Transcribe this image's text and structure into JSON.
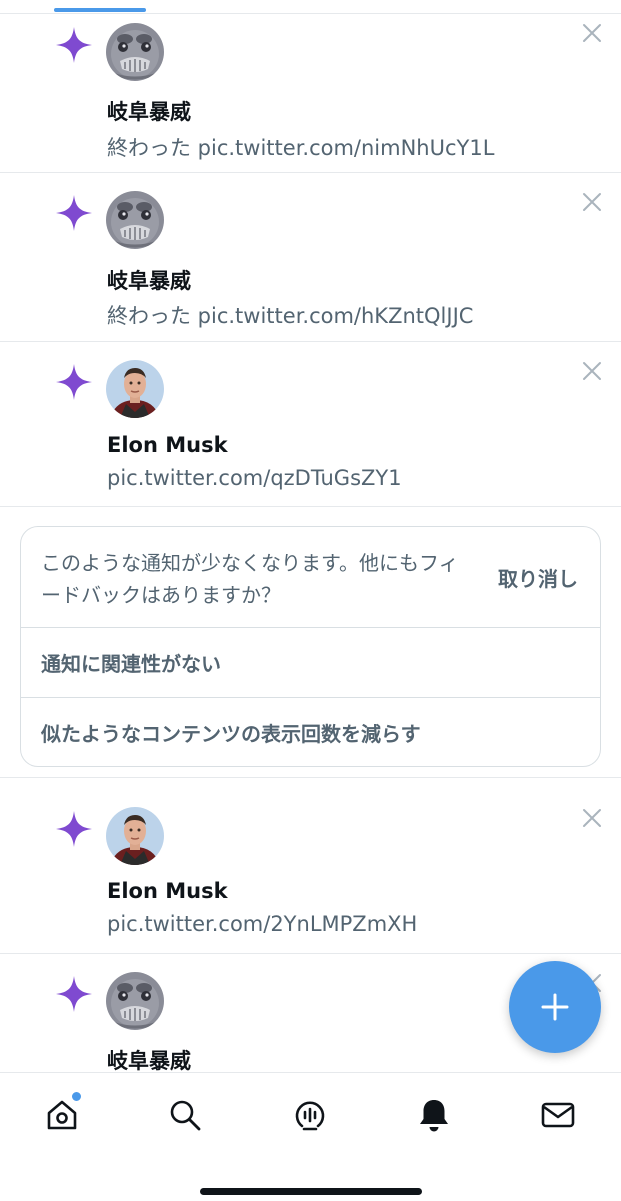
{
  "colors": {
    "accent": "#4a99e9",
    "star": "#7f4ad0",
    "secondary_text": "#536471",
    "primary_text": "#0f1419"
  },
  "notifications_top": [
    {
      "icon": "sparkle-icon",
      "avatar": "gifu-avatar",
      "name": "岐阜暴威",
      "text": "終わった pic.twitter.com/nimNhUcY1L"
    },
    {
      "icon": "sparkle-icon",
      "avatar": "gifu-avatar",
      "name": "岐阜暴威",
      "text": "終わった pic.twitter.com/hKZntQlJJC"
    },
    {
      "icon": "sparkle-icon",
      "avatar": "elon-avatar",
      "name": "Elon Musk",
      "text": "pic.twitter.com/qzDTuGsZY1"
    }
  ],
  "feedback": {
    "message": "このような通知が少なくなります。他にもフィードバックはありますか？",
    "undo_label": "取り消し",
    "options": [
      "通知に関連性がない",
      "似たようなコンテンツの表示回数を減らす"
    ]
  },
  "notifications_bottom": [
    {
      "icon": "sparkle-icon",
      "avatar": "elon-avatar",
      "name": "Elon Musk",
      "text": "pic.twitter.com/2YnLMPZmXH"
    },
    {
      "icon": "sparkle-icon",
      "avatar": "gifu-avatar",
      "name": "岐阜暴威",
      "text": ""
    }
  ],
  "fab": {
    "icon": "plus-icon"
  },
  "tabbar": {
    "items": [
      {
        "icon": "home-icon",
        "has_badge": true
      },
      {
        "icon": "search-icon"
      },
      {
        "icon": "spaces-icon"
      },
      {
        "icon": "bell-icon",
        "active": true
      },
      {
        "icon": "mail-icon"
      }
    ]
  }
}
